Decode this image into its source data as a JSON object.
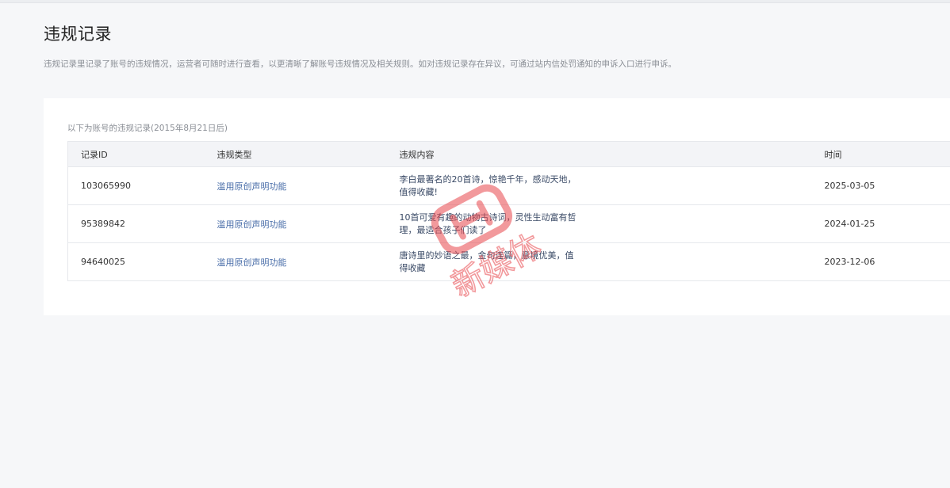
{
  "page": {
    "title": "违规记录",
    "description": "违规记录里记录了账号的违规情况，运营者可随时进行查看，以更清晰了解账号违规情况及相关规则。如对违规记录存在异议，可通过站内信处罚通知的申诉入口进行申诉。"
  },
  "table": {
    "caption": "以下为账号的违规记录(2015年8月21日后)",
    "headers": {
      "id": "记录ID",
      "type": "违规类型",
      "content": "违规内容",
      "time": "时间"
    },
    "rows": [
      {
        "id": "103065990",
        "type": "滥用原创声明功能",
        "content": "李白最著名的20首诗，惊艳千年，感动天地，值得收藏!",
        "time": "2025-03-05"
      },
      {
        "id": "95389842",
        "type": "滥用原创声明功能",
        "content": "10首可爱有趣的动物古诗词，灵性生动富有哲理，最适合孩子们读了",
        "time": "2024-01-25"
      },
      {
        "id": "94640025",
        "type": "滥用原创声明功能",
        "content": "唐诗里的妙语之最，金句连篇，意境优美，值得收藏",
        "time": "2023-12-06"
      }
    ]
  },
  "watermark": {
    "logo_text": "新媒体",
    "color": "#e8474d"
  }
}
